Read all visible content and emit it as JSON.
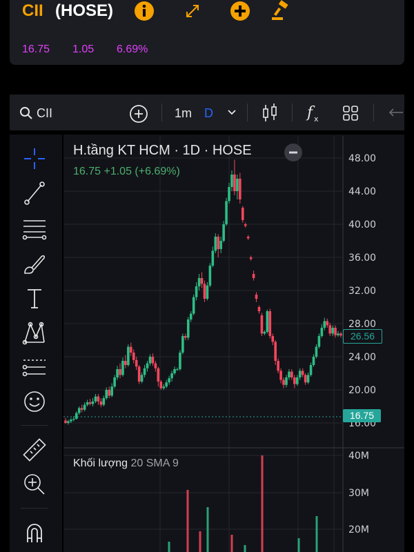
{
  "header": {
    "symbol": "CII",
    "exchange": "(HOSE)",
    "price": "16.75",
    "change": "1.05",
    "change_pct": "6.69%",
    "icons": [
      "info-icon",
      "expand-icon",
      "add-icon",
      "auction-gavel-icon"
    ]
  },
  "toolbar": {
    "search_label": "CII",
    "interval_1": "1m",
    "interval_2": "D",
    "icons": [
      "search-icon",
      "add-icon",
      "chevron-down-icon",
      "candlestick-icon",
      "function-fx-icon",
      "grid-layout-icon",
      "undo-icon"
    ]
  },
  "tools": [
    "crosshair-icon",
    "trend-line-icon",
    "fib-lines-icon",
    "brush-icon",
    "text-icon",
    "pattern-icon",
    "forecast-icon",
    "emoji-icon",
    "ruler-icon",
    "zoom-in-icon",
    "magnet-icon"
  ],
  "chart": {
    "title": "H.tầng KT HCM · 1D · HOSE",
    "quote": "16.75  +1.05 (+6.69%)",
    "price_tag_current": "26.56",
    "price_tag_last": "16.75",
    "volume_title": "Khối lượng",
    "volume_params": "20 SMA 9"
  },
  "chart_data": {
    "type": "candlestick",
    "y_ticks": [
      "48.00",
      "44.00",
      "40.00",
      "36.00",
      "32.00",
      "28.00",
      "24.00",
      "20.00",
      "16.00"
    ],
    "volume_ticks": [
      "40M",
      "30M",
      "20M"
    ],
    "ylim": [
      15.5,
      49
    ],
    "candles": [
      [
        16.3,
        16.0,
        16.6,
        15.9
      ],
      [
        16.0,
        16.2,
        16.4,
        15.8
      ],
      [
        16.2,
        16.4,
        16.6,
        16.0
      ],
      [
        16.4,
        16.5,
        16.8,
        16.2
      ],
      [
        16.5,
        17.2,
        17.4,
        16.4
      ],
      [
        17.2,
        17.8,
        18.0,
        17.0
      ],
      [
        17.8,
        17.6,
        18.2,
        17.3
      ],
      [
        17.6,
        18.2,
        18.5,
        17.4
      ],
      [
        18.2,
        18.5,
        18.8,
        18.0
      ],
      [
        18.5,
        18.3,
        18.9,
        18.1
      ],
      [
        18.3,
        18.6,
        19.0,
        18.0
      ],
      [
        18.6,
        19.2,
        19.5,
        18.4
      ],
      [
        19.2,
        18.6,
        19.5,
        18.2
      ],
      [
        18.6,
        18.2,
        19.0,
        17.9
      ],
      [
        18.2,
        19.0,
        19.3,
        18.0
      ],
      [
        19.0,
        20.0,
        20.3,
        18.8
      ],
      [
        20.0,
        19.3,
        20.4,
        19.0
      ],
      [
        19.3,
        20.4,
        20.8,
        19.1
      ],
      [
        20.4,
        21.5,
        21.8,
        20.2
      ],
      [
        21.5,
        22.5,
        22.9,
        21.2
      ],
      [
        22.5,
        21.8,
        23.2,
        21.4
      ],
      [
        21.8,
        23.5,
        23.9,
        21.6
      ],
      [
        23.5,
        23.0,
        24.2,
        22.6
      ],
      [
        23.0,
        25.2,
        25.5,
        22.8
      ],
      [
        25.2,
        24.5,
        25.7,
        24.1
      ],
      [
        24.5,
        23.6,
        24.9,
        23.2
      ],
      [
        23.6,
        22.8,
        24.0,
        22.4
      ],
      [
        22.8,
        21.0,
        23.0,
        20.7
      ],
      [
        21.0,
        21.8,
        22.1,
        20.8
      ],
      [
        21.8,
        22.6,
        23.0,
        21.5
      ],
      [
        22.6,
        23.2,
        23.5,
        22.2
      ],
      [
        23.2,
        24.0,
        24.3,
        22.9
      ],
      [
        24.0,
        23.2,
        24.4,
        22.9
      ],
      [
        23.2,
        22.6,
        23.5,
        22.2
      ],
      [
        22.6,
        21.0,
        22.8,
        20.4
      ],
      [
        21.0,
        20.2,
        21.2,
        20.0
      ],
      [
        20.2,
        20.4,
        20.7,
        20.0
      ],
      [
        20.4,
        20.9,
        21.2,
        20.2
      ],
      [
        20.9,
        21.4,
        21.7,
        20.6
      ],
      [
        21.4,
        22.0,
        22.3,
        21.0
      ],
      [
        22.0,
        22.5,
        22.8,
        21.8
      ],
      [
        22.5,
        22.5,
        22.7,
        22.3
      ],
      [
        22.5,
        24.5,
        24.8,
        22.3
      ],
      [
        24.5,
        26.5,
        26.8,
        24.3
      ],
      [
        26.5,
        26.3,
        26.8,
        26.0
      ],
      [
        26.3,
        28.5,
        28.8,
        26.0
      ],
      [
        28.5,
        29.2,
        29.5,
        28.2
      ],
      [
        29.2,
        31.2,
        31.5,
        29.0
      ],
      [
        31.2,
        32.5,
        33.0,
        30.8
      ],
      [
        32.5,
        33.5,
        34.0,
        32.0
      ],
      [
        33.5,
        32.8,
        34.2,
        32.3
      ],
      [
        32.8,
        31.0,
        33.2,
        30.6
      ],
      [
        31.0,
        32.6,
        33.0,
        30.8
      ],
      [
        32.6,
        35.0,
        35.3,
        32.4
      ],
      [
        35.0,
        36.8,
        37.3,
        34.8
      ],
      [
        36.8,
        38.5,
        38.9,
        36.5
      ],
      [
        38.5,
        37.0,
        38.8,
        36.0
      ],
      [
        37.0,
        38.0,
        38.5,
        36.5
      ],
      [
        38.0,
        40.0,
        40.4,
        37.8
      ],
      [
        40.0,
        42.8,
        43.2,
        39.8
      ],
      [
        42.8,
        44.5,
        45.0,
        42.5
      ],
      [
        44.5,
        46.0,
        46.5,
        44.0
      ],
      [
        46.0,
        44.0,
        47.8,
        43.5
      ],
      [
        44.0,
        45.5,
        46.0,
        43.0
      ],
      [
        45.5,
        43.0,
        46.2,
        42.5
      ],
      [
        42.0,
        40.5,
        42.2,
        40.2
      ],
      [
        40.0,
        39.8,
        40.2,
        39.6
      ],
      [
        38.5,
        38.3,
        38.7,
        38.1
      ],
      [
        36.0,
        35.8,
        36.2,
        35.6
      ],
      [
        34.0,
        33.5,
        34.4,
        33.2
      ],
      [
        31.5,
        31.0,
        31.8,
        30.6
      ],
      [
        30.0,
        29.5,
        30.2,
        29.2
      ],
      [
        29.0,
        26.8,
        29.3,
        26.5
      ],
      [
        26.8,
        27.0,
        27.2,
        26.6
      ],
      [
        27.0,
        29.5,
        29.7,
        26.8
      ],
      [
        29.5,
        26.5,
        29.8,
        26.2
      ],
      [
        26.5,
        25.8,
        26.8,
        25.4
      ],
      [
        25.8,
        23.5,
        26.0,
        23.0
      ],
      [
        23.5,
        22.3,
        23.8,
        22.0
      ],
      [
        22.3,
        21.2,
        22.6,
        20.8
      ],
      [
        21.2,
        20.6,
        21.5,
        20.2
      ],
      [
        20.6,
        21.5,
        21.8,
        20.3
      ],
      [
        21.5,
        22.2,
        22.5,
        21.2
      ],
      [
        22.2,
        21.5,
        22.5,
        21.2
      ],
      [
        21.5,
        20.7,
        21.8,
        20.2
      ],
      [
        20.7,
        21.5,
        21.8,
        20.5
      ],
      [
        21.5,
        22.3,
        22.6,
        21.2
      ],
      [
        22.3,
        21.8,
        22.6,
        21.5
      ],
      [
        21.8,
        20.9,
        22.0,
        20.6
      ],
      [
        20.9,
        21.8,
        22.1,
        20.7
      ],
      [
        21.8,
        23.0,
        23.3,
        21.6
      ],
      [
        23.0,
        24.0,
        24.3,
        22.8
      ],
      [
        24.0,
        25.2,
        25.5,
        23.8
      ],
      [
        25.2,
        26.5,
        26.8,
        25.0
      ],
      [
        26.5,
        27.5,
        27.9,
        26.3
      ],
      [
        27.5,
        28.3,
        28.7,
        27.2
      ],
      [
        28.3,
        27.8,
        28.6,
        27.5
      ],
      [
        27.8,
        26.8,
        28.1,
        26.5
      ],
      [
        26.8,
        27.5,
        27.8,
        26.5
      ],
      [
        27.5,
        26.6,
        27.8,
        26.3
      ],
      [
        26.6,
        26.8,
        27.1,
        26.4
      ],
      [
        26.8,
        26.56,
        27.0,
        26.3
      ]
    ],
    "last_price": 16.75
  }
}
